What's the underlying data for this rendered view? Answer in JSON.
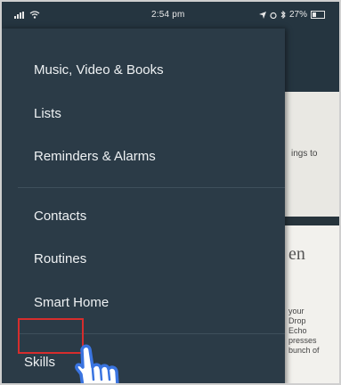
{
  "status_bar": {
    "time": "2:54 pm",
    "battery": "27%"
  },
  "drawer": {
    "items": [
      {
        "label": "Music, Video & Books"
      },
      {
        "label": "Lists"
      },
      {
        "label": "Reminders & Alarms"
      },
      {
        "label": "Contacts"
      },
      {
        "label": "Routines"
      },
      {
        "label": "Smart Home"
      },
      {
        "label": "Skills"
      }
    ],
    "highlighted_item": "Skills",
    "highlight_color": "#d62d2d"
  },
  "background": {
    "snippet": "ings to",
    "heading": "en",
    "lines": [
      "your",
      "Drop",
      "Echo",
      "presses",
      "bunch of"
    ]
  },
  "colors": {
    "drawer_bg": "#2b3b47",
    "text": "#eef1f3",
    "pointer": "#3a74e0"
  },
  "icons": {
    "pointer": "hand-pointer-icon"
  }
}
